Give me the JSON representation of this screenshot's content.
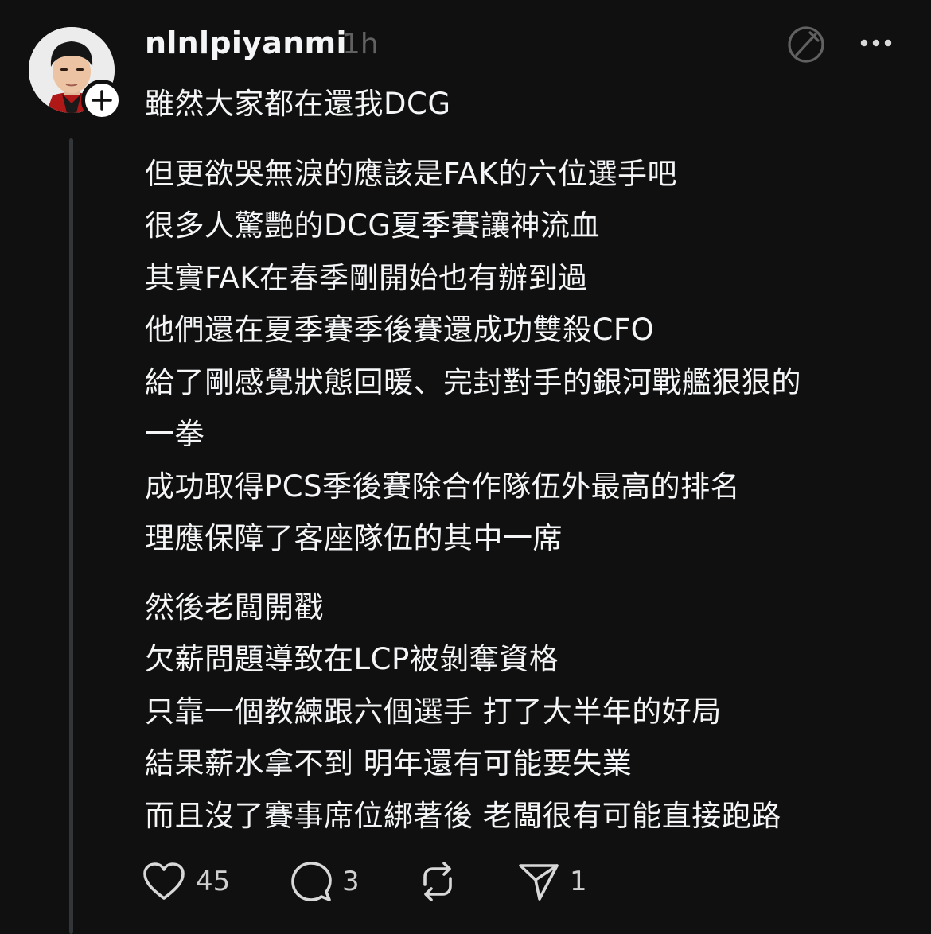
{
  "post": {
    "username": "nlnlpiyanmi",
    "timestamp": "1h",
    "paragraphs": {
      "p0": [
        "雖然大家都在還我DCG"
      ],
      "p1": [
        "但更欲哭無淚的應該是FAK的六位選手吧",
        "很多人驚艷的DCG夏季賽讓神流血",
        "其實FAK在春季剛開始也有辦到過",
        "他們還在夏季賽季後賽還成功雙殺CFO",
        "給了剛感覺狀態回暖、完封對手的銀河戰艦狠狠的",
        "一拳",
        "成功取得PCS季後賽除合作隊伍外最高的排名",
        "理應保障了客座隊伍的其中一席"
      ],
      "p2": [
        "然後老闆開戳",
        "欠薪問題導致在LCP被剝奪資格",
        "只靠一個教練跟六個選手 打了大半年的好局",
        "結果薪水拿不到 明年還有可能要失業",
        "而且沒了賽事席位綁著後 老闆很有可能直接跑路"
      ]
    }
  },
  "actions": {
    "like_count": "45",
    "comment_count": "3",
    "share_count": "1"
  },
  "icons": {
    "follow": "plus-icon",
    "translate": "translate-icon",
    "more": "more-icon",
    "like": "heart-icon",
    "comment": "comment-icon",
    "repost": "repost-icon",
    "share": "send-icon"
  },
  "colors": {
    "background": "#101010",
    "text": "#f3f5f7",
    "muted": "#616161",
    "thread_line": "#333638"
  }
}
